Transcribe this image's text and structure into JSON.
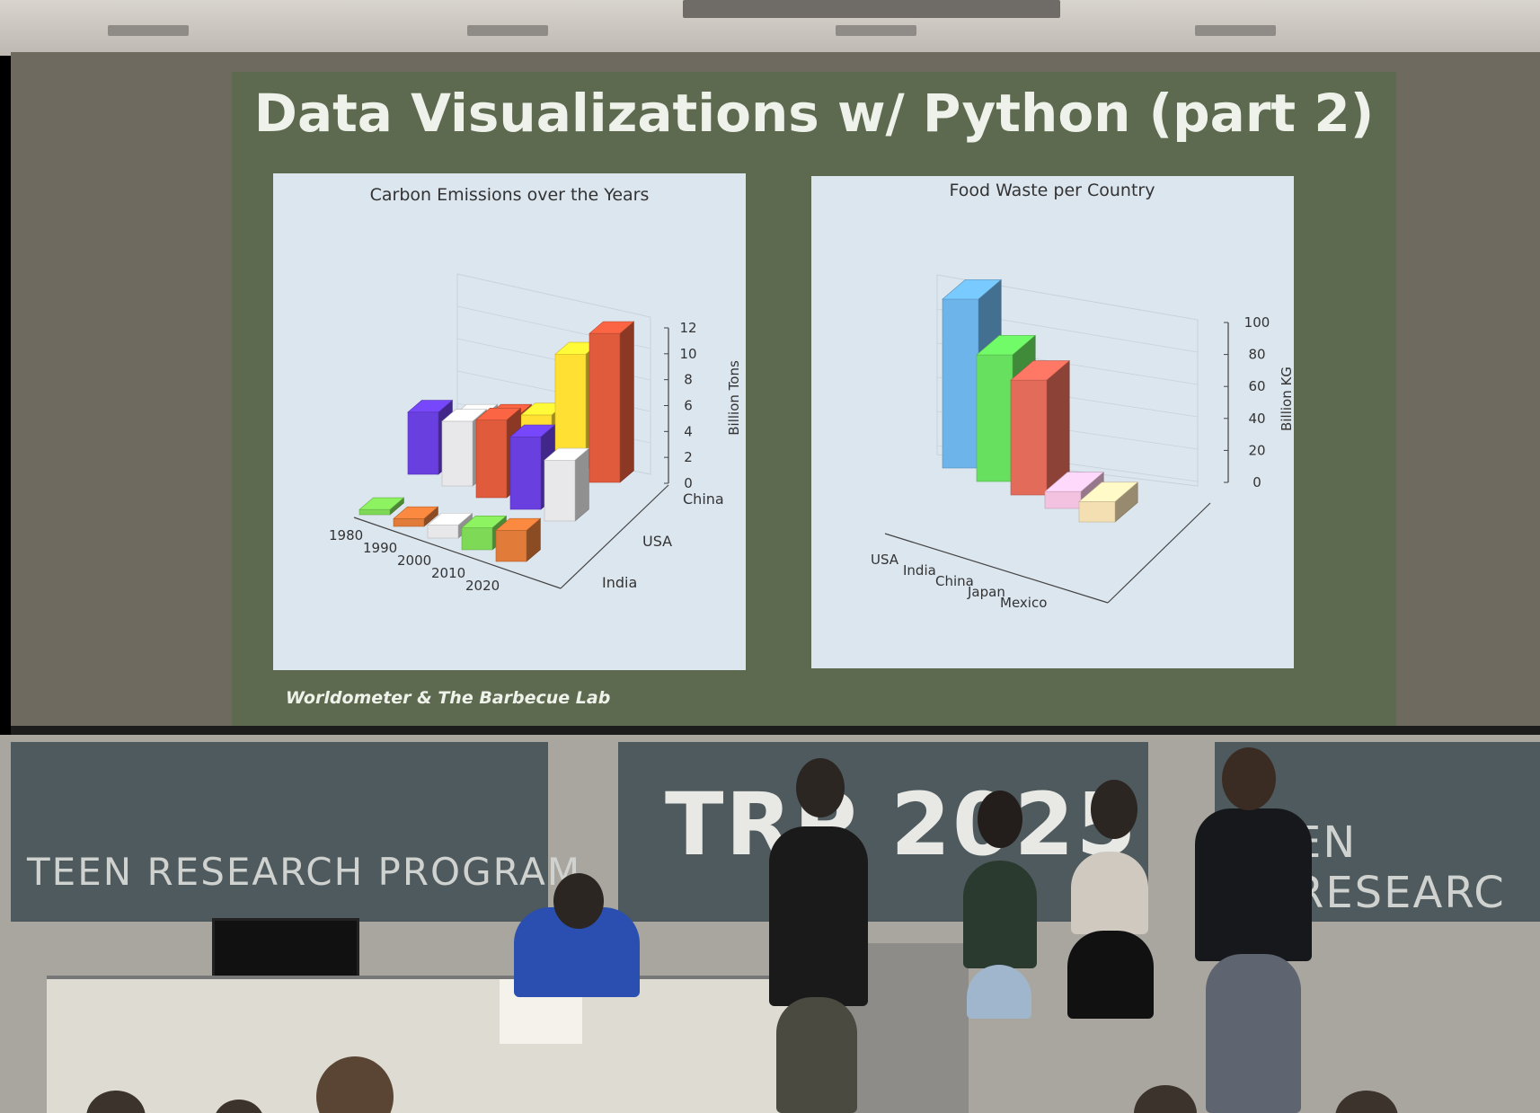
{
  "slide": {
    "title": "Data Visualizations w/ Python (part 2)",
    "source": "Worldometer & The Barbecue Lab",
    "background_color": "#5d6a4f"
  },
  "chalkboard": {
    "left_text": "TEEN RESEARCH PROGRAM",
    "center_text": "TRP 2025",
    "right_text": "EN RESEARC"
  },
  "chart_data": [
    {
      "type": "bar",
      "title": "Carbon Emissions over the Years",
      "categories": [
        "1980",
        "1990",
        "2000",
        "2010",
        "2020"
      ],
      "zlabel": "Billion Tons",
      "zticks": [
        "0",
        "2",
        "4",
        "6",
        "8",
        "10",
        "12"
      ],
      "zlim": [
        0,
        12
      ],
      "series": [
        {
          "name": "India",
          "values": [
            0.4,
            0.6,
            1.0,
            1.7,
            2.4
          ],
          "colors": [
            "#7ed957",
            "#e07b39",
            "#e8e8ea",
            "#7ed957",
            "#e07b39"
          ]
        },
        {
          "name": "USA",
          "values": [
            4.8,
            5.0,
            6.0,
            5.6,
            4.7
          ],
          "colors": [
            "#6a3fe0",
            "#e8e8ea",
            "#e05a3c",
            "#6a3fe0",
            "#e8e8ea"
          ]
        },
        {
          "name": "China",
          "values": [
            1.5,
            2.4,
            3.4,
            9.0,
            11.5
          ],
          "colors": [
            "#e8e8ea",
            "#e05a3c",
            "#ffe033",
            "#ffe033",
            "#e05a3c"
          ]
        }
      ]
    },
    {
      "type": "bar",
      "title": "Food Waste per Country",
      "categories": [
        "USA",
        "India",
        "China",
        "Japan",
        "Mexico"
      ],
      "zlabel": "Billion KG",
      "zticks": [
        "0",
        "20",
        "40",
        "60",
        "80",
        "100"
      ],
      "zlim": [
        0,
        100
      ],
      "values": [
        100,
        75,
        68,
        10,
        12
      ],
      "colors": [
        "#6cb4ea",
        "#66e05e",
        "#e36b5a",
        "#f3c2e0",
        "#f4dfb3"
      ]
    }
  ]
}
